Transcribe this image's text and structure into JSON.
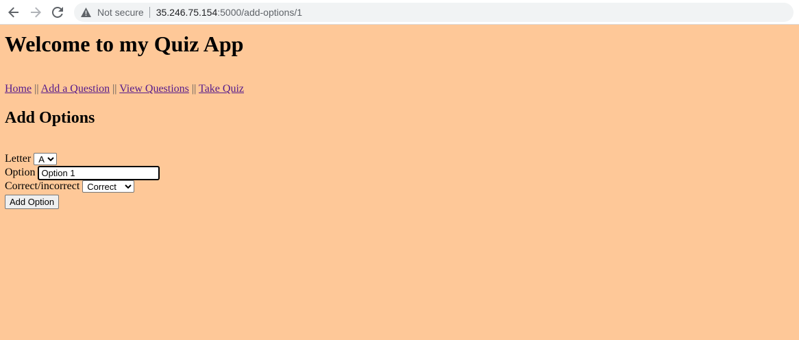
{
  "browser": {
    "security_label": "Not secure",
    "url_host": "35.246.75.154",
    "url_rest": ":5000/add-options/1"
  },
  "page": {
    "title": "Welcome to my Quiz App",
    "nav": {
      "home": "Home",
      "add_question": "Add a Question",
      "view_questions": "View Questions",
      "take_quiz": "Take Quiz",
      "separator": "||"
    },
    "heading": "Add Options",
    "form": {
      "letter_label": "Letter",
      "letter_value": "A",
      "option_label": "Option",
      "option_value": "Option 1",
      "correct_label": "Correct/incorrect",
      "correct_value": "Correct",
      "submit_label": "Add Option"
    }
  },
  "colors": {
    "page_background": "#fec898",
    "link": "#551a8b"
  }
}
